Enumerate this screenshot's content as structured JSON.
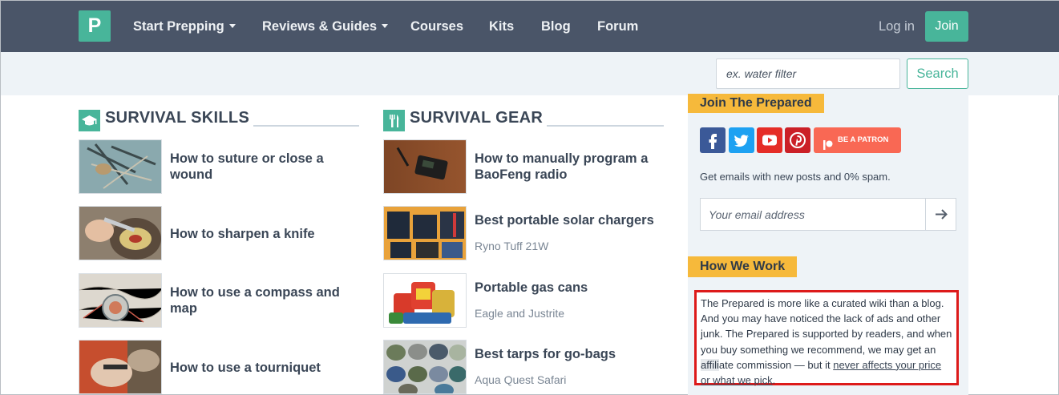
{
  "nav": {
    "logo": "P",
    "items": [
      {
        "label": "Start Prepping",
        "dropdown": true
      },
      {
        "label": "Reviews & Guides",
        "dropdown": true
      },
      {
        "label": "Courses",
        "dropdown": false
      },
      {
        "label": "Kits",
        "dropdown": false
      },
      {
        "label": "Blog",
        "dropdown": false
      },
      {
        "label": "Forum",
        "dropdown": false
      }
    ],
    "login": "Log in",
    "join": "Join"
  },
  "search": {
    "placeholder": "ex. water filter",
    "button": "Search"
  },
  "skills": {
    "title": "SURVIVAL SKILLS",
    "icon": "graduation-cap-icon",
    "items": [
      {
        "title": "How to suture or close a wound"
      },
      {
        "title": "How to sharpen a knife"
      },
      {
        "title": "How to use a compass and map"
      },
      {
        "title": "How to use a tourniquet"
      }
    ]
  },
  "gear": {
    "title": "SURVIVAL GEAR",
    "icon": "utensils-icon",
    "items": [
      {
        "title": "How to manually program a BaoFeng radio",
        "sub": ""
      },
      {
        "title": "Best portable solar chargers",
        "sub": "Ryno Tuff 21W"
      },
      {
        "title": "Portable gas cans",
        "sub": "Eagle and Justrite"
      },
      {
        "title": "Best tarps for go-bags",
        "sub": "Aqua Quest Safari"
      }
    ]
  },
  "sidebar": {
    "join_title": "Join The Prepared",
    "patron_label": "BE A PATRON",
    "email_note": "Get emails with new posts and 0% spam.",
    "email_placeholder": "Your email address",
    "how_title": "How We Work",
    "how_text_1": "The Prepared is more like a curated wiki than a blog. And you may have noticed the lack of ads and other junk. The Prepared is supported by readers, and when you buy something we recommend, we may get an ",
    "how_highlight": "affili",
    "how_text_2": "ate commission — but it ",
    "how_link": "never affects your price or what we pick",
    "how_end": "."
  },
  "colors": {
    "nav_bg": "#4a5568",
    "accent": "#48b59a",
    "tag": "#f6b93b",
    "alert_border": "#dd1a1a"
  }
}
